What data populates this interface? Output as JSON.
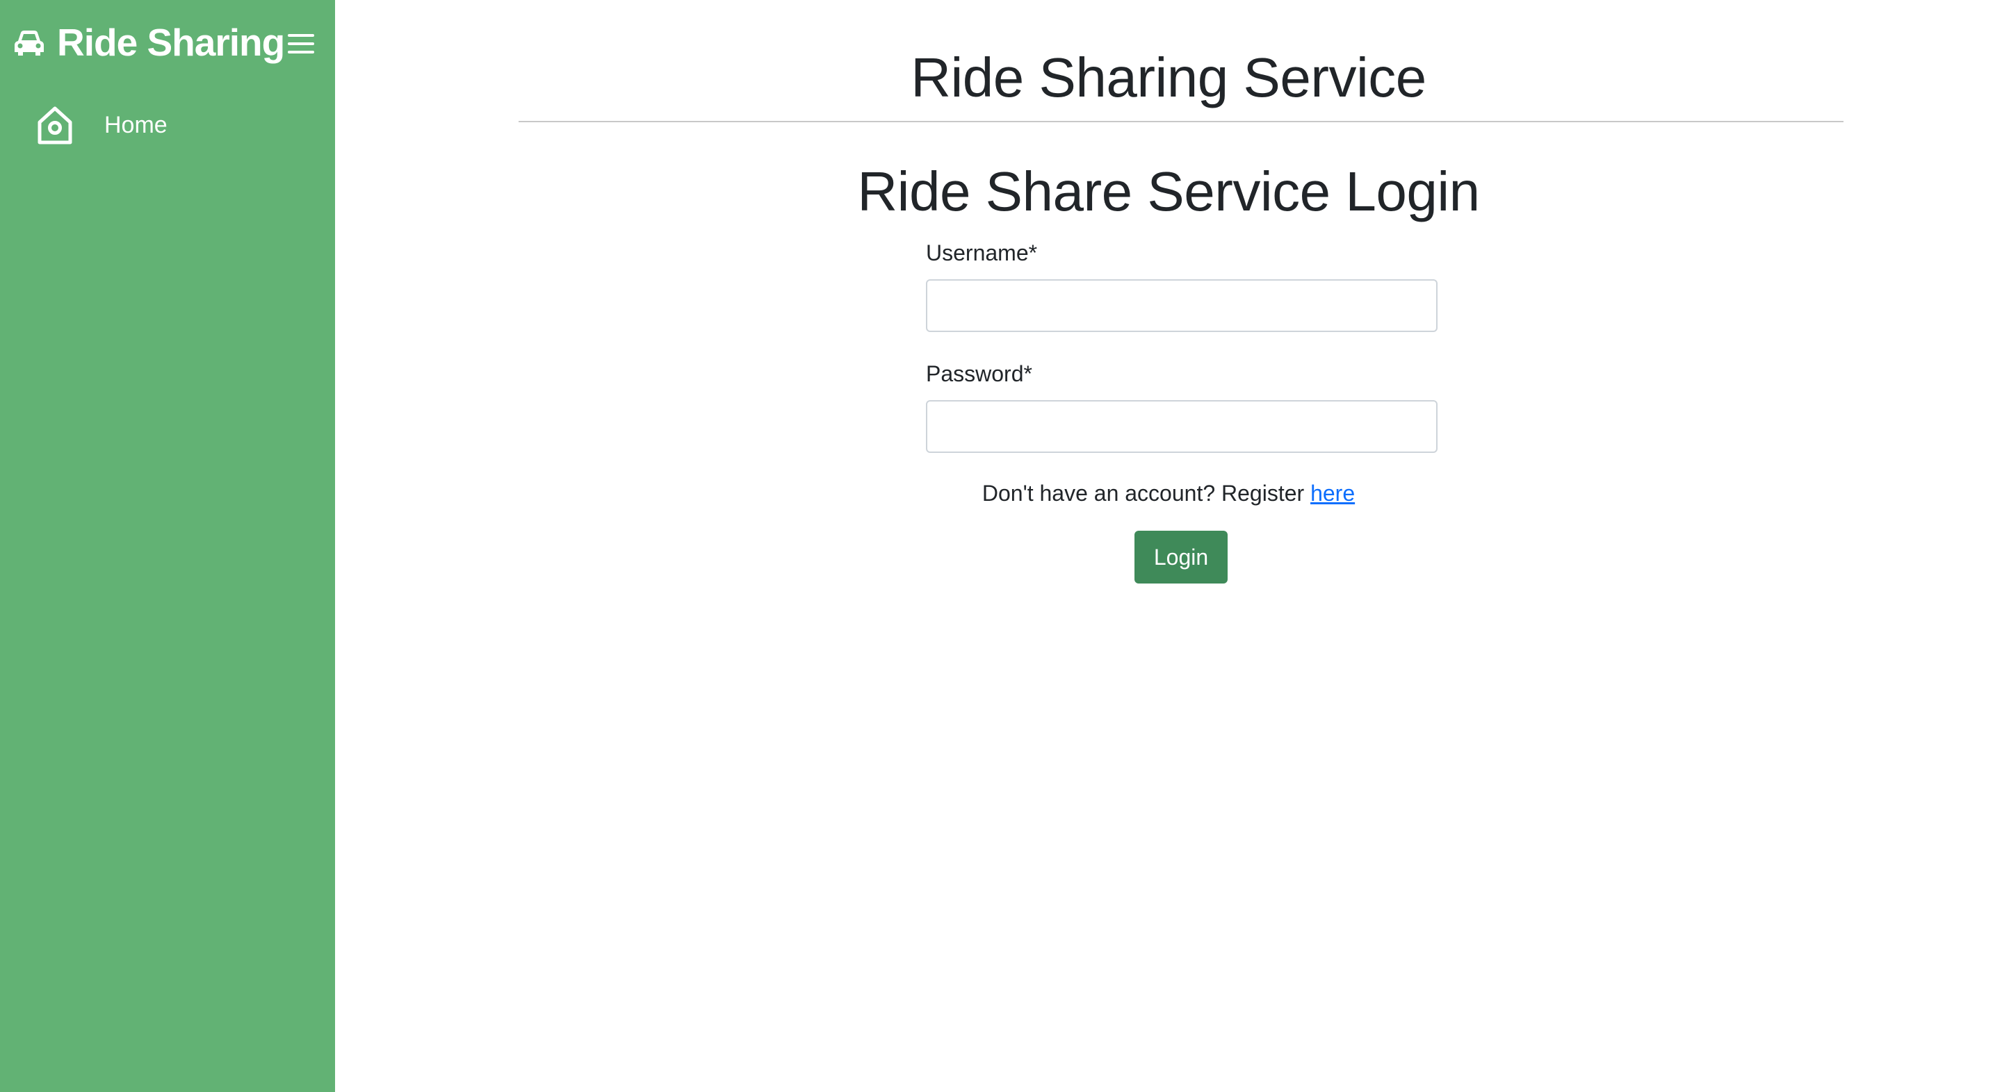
{
  "sidebar": {
    "brand_title": "Ride Sharing",
    "brand_icon": "car-icon",
    "menu_icon": "hamburger-menu-icon",
    "background_color": "#62b274",
    "items": [
      {
        "label": "Home",
        "icon": "home-icon"
      }
    ]
  },
  "main": {
    "page_title": "Ride Sharing Service",
    "login_title": "Ride Share Service Login",
    "form": {
      "username_label": "Username*",
      "username_value": "",
      "password_label": "Password*",
      "password_value": "",
      "register_prompt": "Don't have an account? Register ",
      "register_link": "here",
      "login_button": "Login"
    }
  },
  "colors": {
    "sidebar": "#62b274",
    "button": "#3f8a59",
    "link": "#0d6efd"
  }
}
